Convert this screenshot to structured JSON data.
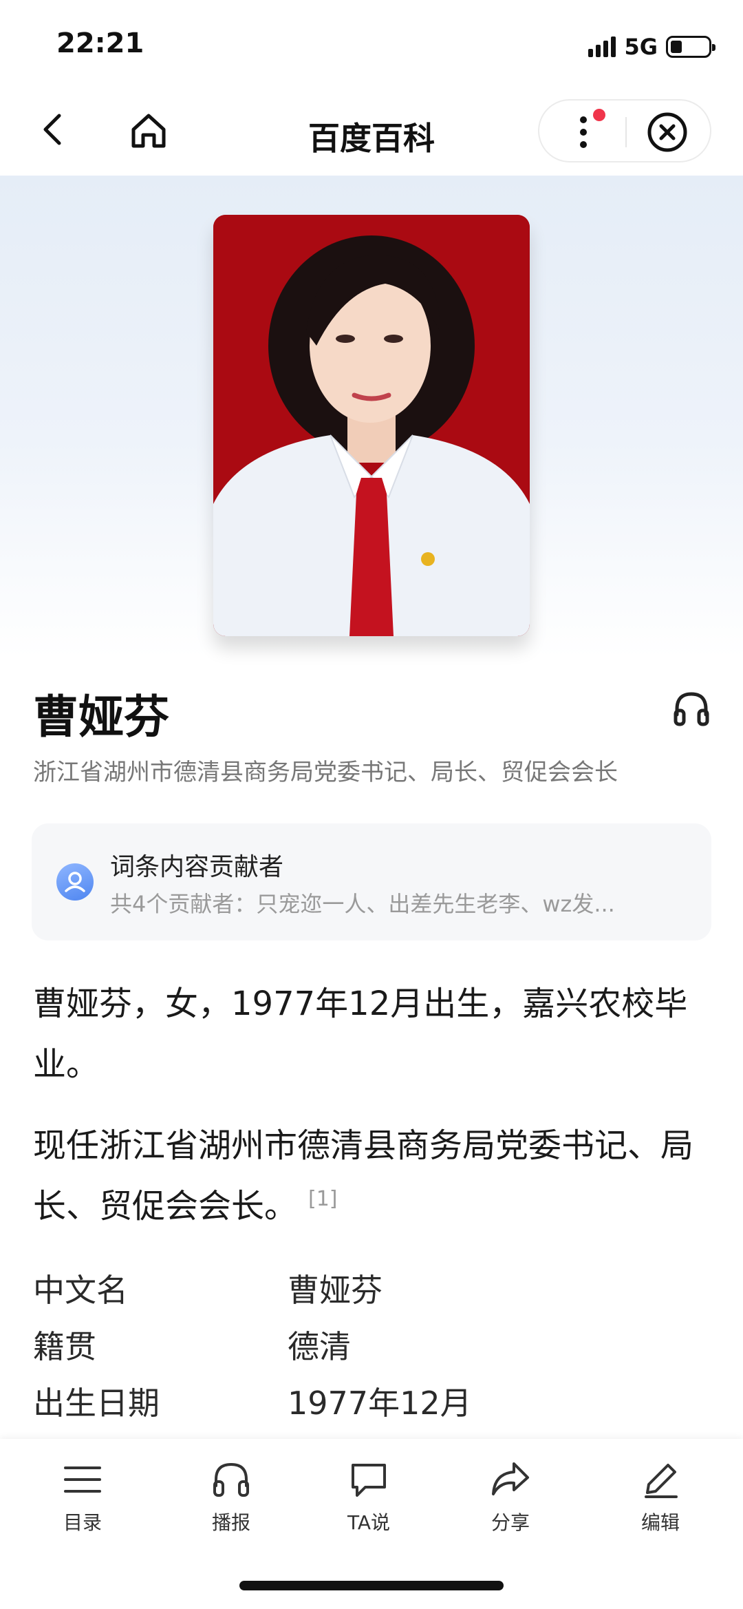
{
  "status_bar": {
    "time": "22:21",
    "network": "5G",
    "battery_level": 0.3,
    "icons": [
      "signal-icon",
      "battery-icon"
    ]
  },
  "nav": {
    "title": "百度百科",
    "icons": [
      "back-arrow-icon",
      "home-icon",
      "more-dots-icon",
      "close-circle-icon"
    ]
  },
  "entry": {
    "name": "曹娅芬",
    "subtitle": "浙江省湖州市德清县商务局党委书记、局长、贸促会会长"
  },
  "contributors": {
    "title": "词条内容贡献者",
    "list": "共4个贡献者：只宠迩一人、出差先生老李、wz发..."
  },
  "body": {
    "para1": "曹娅芬，女，1977年12月出生，嘉兴农校毕业。",
    "para2": "现任浙江省湖州市德清县商务局党委书记、局长、贸促会会长。",
    "citation": "[1]"
  },
  "info": [
    {
      "key": "中文名",
      "value": "曹娅芬"
    },
    {
      "key": "籍贯",
      "value": "德清"
    },
    {
      "key": "出生日期",
      "value": "1977年12月"
    }
  ],
  "bottom_tabs": [
    {
      "label": "目录",
      "icon": "list-icon"
    },
    {
      "label": "播报",
      "icon": "headphones-icon"
    },
    {
      "label": "TA说",
      "icon": "chat-bubble-icon"
    },
    {
      "label": "分享",
      "icon": "share-arrow-icon"
    },
    {
      "label": "编辑",
      "icon": "pen-icon"
    }
  ],
  "colors": {
    "photo_background": "#aa0a12",
    "notification_dot": "#f0354b",
    "hero_gradient_top": "#e5edf7"
  }
}
